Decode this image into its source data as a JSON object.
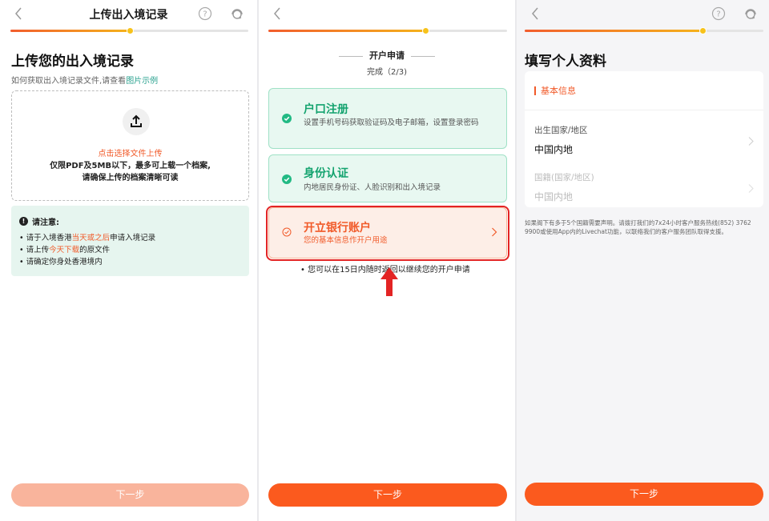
{
  "upload_screen": {
    "title": "上传出入境记录",
    "heading": "上传您的出入境记录",
    "hint_prefix": "如何获取出入境记录文件,请查看",
    "hint_link": "图片示例",
    "upload_cta": "点击选择文件上传",
    "upload_desc_line1": "仅限PDF及5MB以下，最多可上载一个档案,",
    "upload_desc_line2": "请确保上传的档案清晰可读",
    "notice_title": "请注意:",
    "notice_items": [
      {
        "pre": "• 请于入境香港",
        "hl": "当天或之后",
        "post": "申请入境记录"
      },
      {
        "pre": "• 请上传",
        "hl": "今天下载",
        "post": "的原文件"
      },
      {
        "pre": "• 请确定你身处香港境内",
        "hl": "",
        "post": ""
      }
    ],
    "next_label": "下一步",
    "progress": 0.5,
    "next_enabled": false
  },
  "application_screen": {
    "section_title": "开户申请",
    "progress_text": "完成（2/3)",
    "steps": [
      {
        "title": "户口注册",
        "desc": "设置手机号码获取验证码及电子邮箱，设置登录密码",
        "status": "done"
      },
      {
        "title": "身份认证",
        "desc": "内地居民身份证、人脸识别和出入境记录",
        "status": "done"
      },
      {
        "title": "开立银行账户",
        "desc": "您的基本信息作开户用途",
        "status": "current"
      }
    ],
    "note": "• 您可以在15日内随时返回以继续您的开户申请",
    "next_label": "下一步",
    "progress": 0.66
  },
  "profile_screen": {
    "heading": "填写个人资料",
    "card_title": "基本信息",
    "fields": [
      {
        "label": "出生国家/地区",
        "value": "中国内地",
        "enabled": true
      },
      {
        "label": "国籍(国家/地区)",
        "value": "中国内地",
        "enabled": false
      }
    ],
    "disclaimer": "如果阁下有多于5个国籍需要声明。请拨打我们的7x24小时客户服务热线(852) 3762 9900或使用App内的Livechat功能，以联络我们的客户服务团队取得支援。",
    "next_label": "下一步",
    "progress": 0.75
  },
  "colors": {
    "accent": "#fb5a1e",
    "accent_disabled": "#f9b49c",
    "success": "#22ba84",
    "annotation": "#e32424"
  }
}
